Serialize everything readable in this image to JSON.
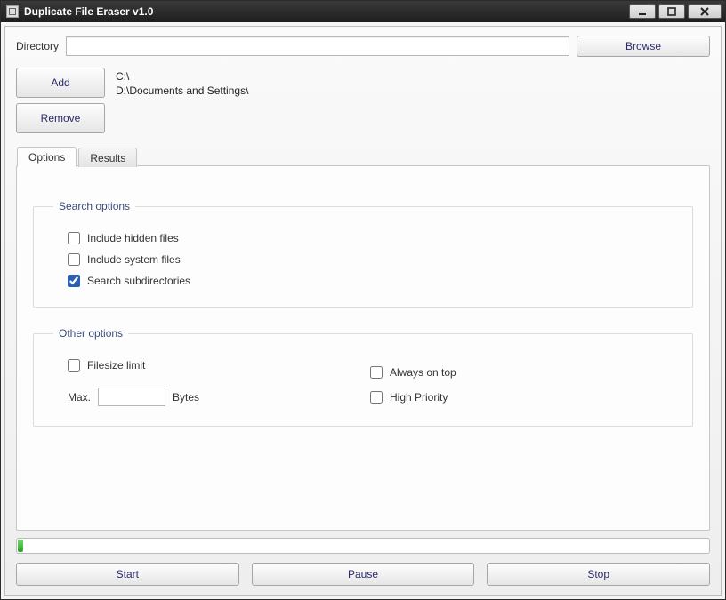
{
  "window": {
    "title": "Duplicate File Eraser v1.0"
  },
  "toolbar": {
    "directory_label": "Directory",
    "directory_value": "",
    "browse": "Browse",
    "add": "Add",
    "remove": "Remove"
  },
  "dir_list": [
    "C:\\",
    "D:\\Documents and Settings\\"
  ],
  "tabs": {
    "options": "Options",
    "results": "Results",
    "active": "options"
  },
  "search_options": {
    "legend": "Search options",
    "include_hidden": {
      "label": "Include hidden files",
      "checked": false
    },
    "include_system": {
      "label": "Include system files",
      "checked": false
    },
    "search_subdirs": {
      "label": "Search subdirectories",
      "checked": true
    }
  },
  "other_options": {
    "legend": "Other options",
    "filesize_limit": {
      "label": "Filesize limit",
      "checked": false
    },
    "max_label": "Max.",
    "max_value": "",
    "bytes_label": "Bytes",
    "always_on_top": {
      "label": "Always on top",
      "checked": false
    },
    "high_priority": {
      "label": "High Priority",
      "checked": false
    }
  },
  "progress": {
    "percent": 1
  },
  "buttons": {
    "start": "Start",
    "pause": "Pause",
    "stop": "Stop"
  }
}
